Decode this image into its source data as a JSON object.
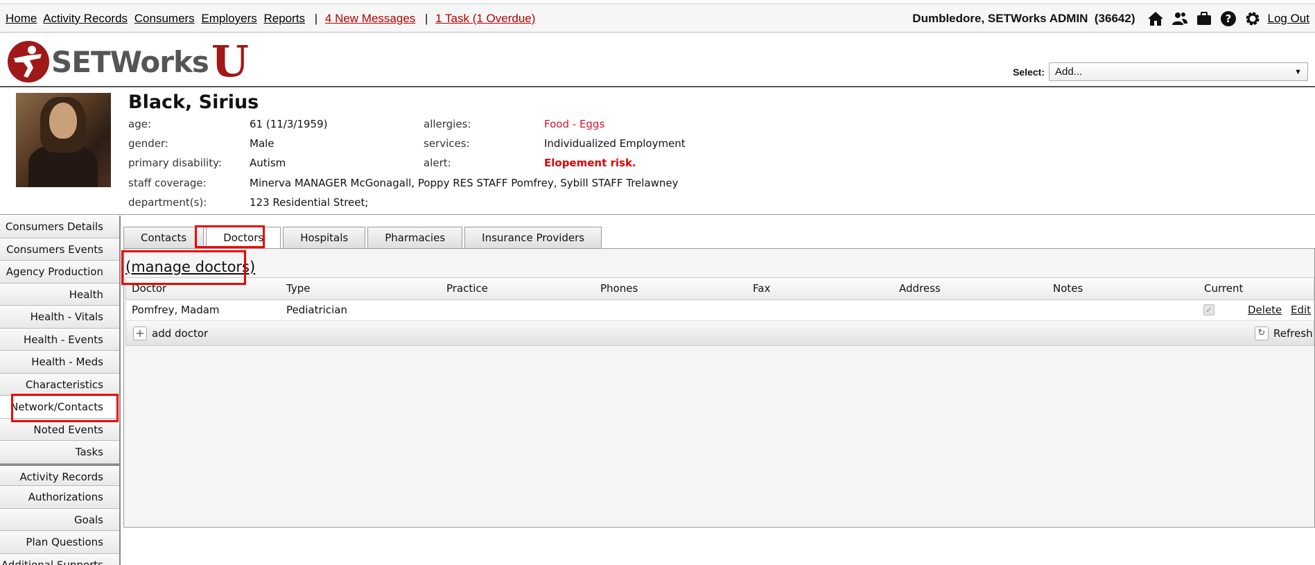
{
  "topnav": {
    "links": [
      "Home",
      "Activity Records",
      "Consumers",
      "Employers",
      "Reports"
    ],
    "separator": "|",
    "messages": "4 New Messages",
    "tasks": "1 Task (1 Overdue)",
    "user": "Dumbledore, SETWorks ADMIN",
    "user_id": "(36642)",
    "icons": [
      "home-icon",
      "users-icon",
      "briefcase-icon",
      "help-icon",
      "gear-icon"
    ],
    "logout": "Log Out"
  },
  "logo": {
    "text": "SETWorks",
    "letter": "U"
  },
  "select": {
    "label": "Select:",
    "value": "Add..."
  },
  "consumer": {
    "name": "Black, Sirius",
    "age_label": "age:",
    "age": "61 (11/3/1959)",
    "gender_label": "gender:",
    "gender": "Male",
    "disability_label": "primary disability:",
    "disability": "Autism",
    "coverage_label": "staff coverage:",
    "coverage": "Minerva MANAGER McGonagall, Poppy RES STAFF Pomfrey, Sybill STAFF Trelawney",
    "department_label": "department(s):",
    "department": "123 Residential Street;",
    "allergies_label": "allergies:",
    "allergies": "Food - Eggs",
    "services_label": "services:",
    "services": "Individualized Employment",
    "alert_label": "alert:",
    "alert": "Elopement risk."
  },
  "sidemenu": [
    "Consumers Details",
    "Consumers Events",
    "Agency Production",
    "Health",
    "Health - Vitals",
    "Health - Events",
    "Health - Meds",
    "Characteristics",
    "Network/Contacts",
    "Noted Events",
    "Tasks",
    "Activity Records",
    "Authorizations",
    "Goals",
    "Plan Questions",
    "Additional Supports"
  ],
  "tabs": [
    "Contacts",
    "Doctors",
    "Hospitals",
    "Pharmacies",
    "Insurance Providers"
  ],
  "manage_link": "(manage doctors)",
  "grid": {
    "columns": [
      "Doctor",
      "Type",
      "Practice",
      "Phones",
      "Fax",
      "Address",
      "Notes",
      "Current"
    ],
    "rows": [
      {
        "doctor": "Pomfrey, Madam",
        "type": "Pediatrician",
        "practice": "",
        "phones": "",
        "fax": "",
        "address": "",
        "notes": "",
        "current": true,
        "delete": "Delete",
        "edit": "Edit"
      }
    ],
    "add_label": "add doctor",
    "refresh_label": "Refresh"
  },
  "colors": {
    "brand_red": "#a01818",
    "alert_red": "#e00000",
    "highlight": "#ee0000"
  }
}
